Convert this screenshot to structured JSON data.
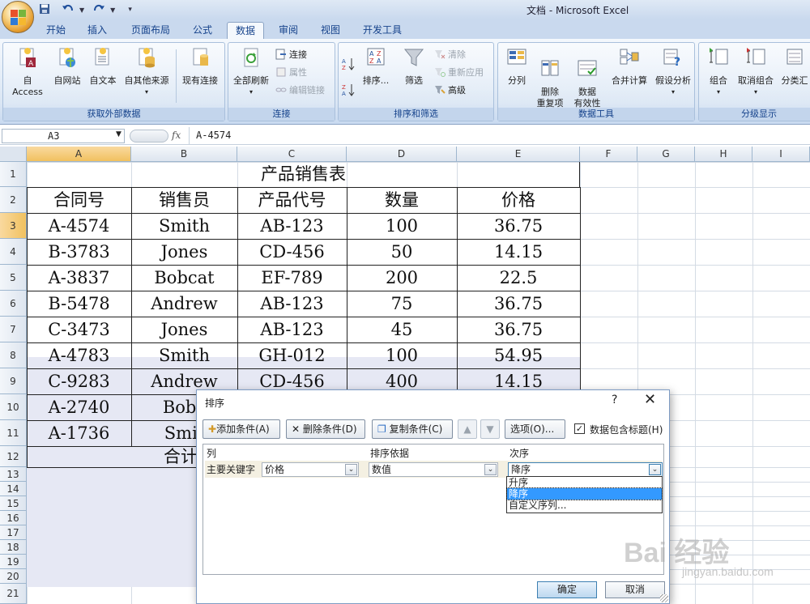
{
  "app_title": "文档 - Microsoft Excel",
  "ribbon_tabs": [
    "开始",
    "插入",
    "页面布局",
    "公式",
    "数据",
    "审阅",
    "视图",
    "开发工具"
  ],
  "active_tab": "数据",
  "groups": {
    "external": {
      "label": "获取外部数据",
      "buttons": [
        "自 Access",
        "自网站",
        "自文本",
        "自其他来源",
        "现有连接"
      ]
    },
    "connections": {
      "label": "连接",
      "refresh_all": "全部刷新",
      "small": [
        "连接",
        "属性",
        "编辑链接"
      ]
    },
    "sortfilter": {
      "label": "排序和筛选",
      "sort": "排序...",
      "filter": "筛选",
      "small": [
        "清除",
        "重新应用",
        "高级"
      ]
    },
    "datatools": {
      "label": "数据工具",
      "buttons": [
        "分列",
        "删除\n重复项",
        "数据\n有效性",
        "合并计算",
        "假设分析"
      ]
    },
    "outline": {
      "label": "分级显示",
      "buttons": [
        "组合",
        "取消组合",
        "分类汇"
      ]
    }
  },
  "formula_bar": {
    "name_box": "A3",
    "fx": "fx",
    "formula": "A-4574"
  },
  "columns": [
    "A",
    "B",
    "C",
    "D",
    "E",
    "F",
    "G",
    "H",
    "I"
  ],
  "rows": [
    "1",
    "2",
    "3",
    "4",
    "5",
    "6",
    "7",
    "8",
    "9",
    "10",
    "11",
    "12",
    "13",
    "14",
    "15",
    "16",
    "17",
    "18",
    "19",
    "20",
    "21"
  ],
  "sheet": {
    "title": "产品销售表",
    "headers": [
      "合同号",
      "销售员",
      "产品代号",
      "数量",
      "价格"
    ],
    "data": [
      [
        "A-4574",
        "Smith",
        "AB-123",
        "100",
        "36.75"
      ],
      [
        "B-3783",
        "Jones",
        "CD-456",
        "50",
        "14.15"
      ],
      [
        "A-3837",
        "Bobcat",
        "EF-789",
        "200",
        "22.5"
      ],
      [
        "B-5478",
        "Andrew",
        "AB-123",
        "75",
        "36.75"
      ],
      [
        "C-3473",
        "Jones",
        "AB-123",
        "45",
        "36.75"
      ],
      [
        "A-4783",
        "Smith",
        "GH-012",
        "100",
        "54.95"
      ],
      [
        "C-9283",
        "Andrew",
        "CD-456",
        "400",
        "14.15"
      ],
      [
        "A-2740",
        "Bobc",
        "",
        "",
        ""
      ],
      [
        "A-1736",
        "Smit",
        "",
        "",
        ""
      ]
    ],
    "total_label": "合计"
  },
  "dialog": {
    "title": "排序",
    "help": "?",
    "close": "✕",
    "add_condition": "添加条件(A)",
    "delete_condition": "删除条件(D)",
    "copy_condition": "复制条件(C)",
    "options": "选项(O)...",
    "has_headers": "数据包含标题(H)",
    "col_header": "列",
    "sort_on_header": "排序依据",
    "order_header": "次序",
    "primary_key": "主要关键字",
    "column_value": "价格",
    "sort_on_value": "数值",
    "order_value": "降序",
    "order_options": [
      "升序",
      "降序",
      "自定义序列..."
    ],
    "ok": "确定",
    "cancel": "取消"
  },
  "watermark": "Bai 经验",
  "watermark_url": "jingyan.baidu.com"
}
